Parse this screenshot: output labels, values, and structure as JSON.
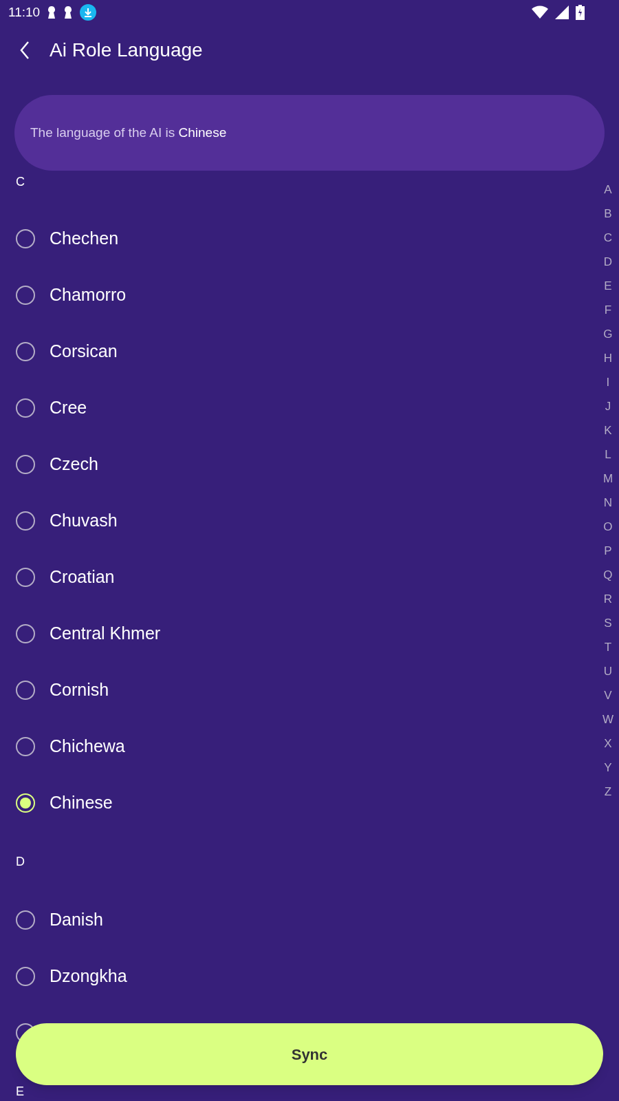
{
  "status_bar": {
    "time": "11:10"
  },
  "header": {
    "title": "Ai Role Language"
  },
  "banner": {
    "text": "The language of the AI is **Chinese**"
  },
  "sections": [
    {
      "letter": "C",
      "items": [
        {
          "label": "Chechen",
          "selected": false
        },
        {
          "label": "Chamorro",
          "selected": false
        },
        {
          "label": "Corsican",
          "selected": false
        },
        {
          "label": "Cree",
          "selected": false
        },
        {
          "label": "Czech",
          "selected": false
        },
        {
          "label": "Chuvash",
          "selected": false
        },
        {
          "label": "Croatian",
          "selected": false
        },
        {
          "label": "Central Khmer",
          "selected": false
        },
        {
          "label": "Cornish",
          "selected": false
        },
        {
          "label": "Chichewa",
          "selected": false
        },
        {
          "label": "Chinese",
          "selected": true
        }
      ]
    },
    {
      "letter": "D",
      "items": [
        {
          "label": "Danish",
          "selected": false
        },
        {
          "label": "Dzongkha",
          "selected": false
        },
        {
          "selected": false
        }
      ]
    },
    {
      "letter": "E"
    }
  ],
  "index_bar": [
    "A",
    "B",
    "C",
    "D",
    "E",
    "F",
    "G",
    "H",
    "I",
    "J",
    "K",
    "L",
    "M",
    "N",
    "O",
    "P",
    "Q",
    "R",
    "S",
    "T",
    "U",
    "V",
    "W",
    "X",
    "Y",
    "Z"
  ],
  "sync_button": {
    "label": "Sync"
  }
}
